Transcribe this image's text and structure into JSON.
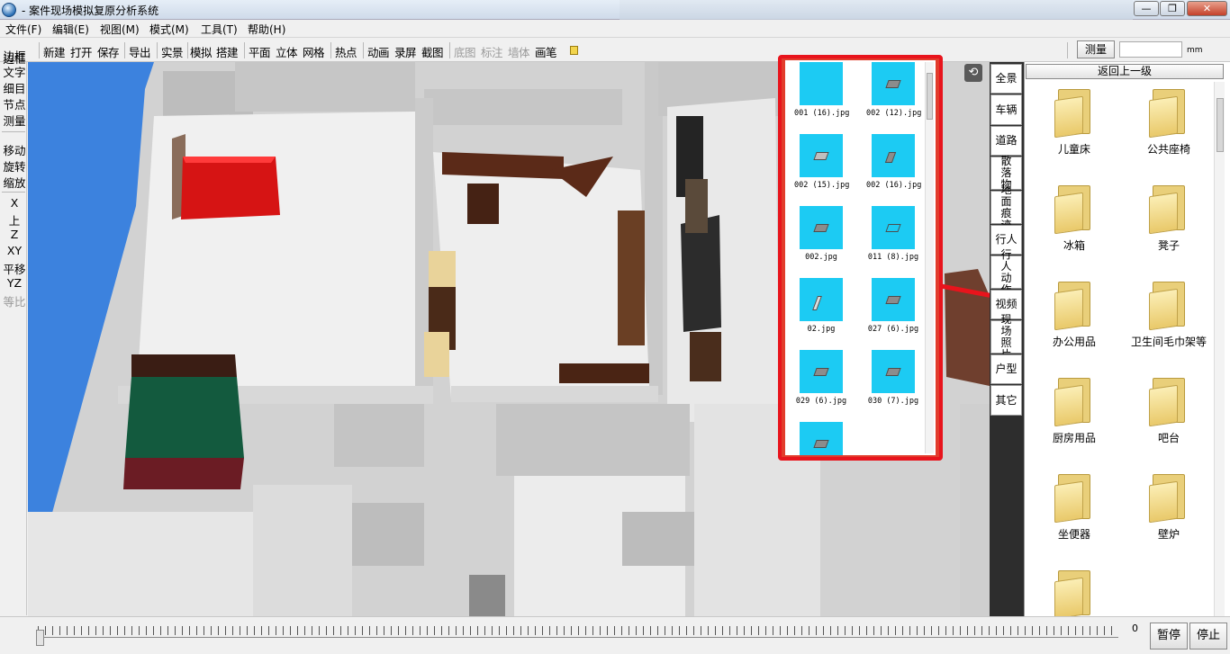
{
  "window": {
    "title": "- 案件现场模拟复原分析系统",
    "minimize": "—",
    "maximize": "❐",
    "close": "✕"
  },
  "menu": [
    "文件(F)",
    "编辑(E)",
    "视图(M)",
    "模式(M)",
    "工具(T)",
    "帮助(H)"
  ],
  "toolbar": {
    "groups": [
      [
        "新建",
        "打开",
        "保存"
      ],
      [
        "导出"
      ],
      [
        "实景",
        "模拟",
        "搭建"
      ],
      [
        "平面",
        "立体",
        "网格"
      ],
      [
        "热点"
      ],
      [
        "动画",
        "录屏",
        "截图"
      ],
      [
        "底图",
        "标注",
        "墙体",
        "画笔"
      ]
    ],
    "disabled": [
      "底图",
      "标注",
      "墙体"
    ],
    "measure_label": "测量",
    "measure_value": "",
    "unit": "mm"
  },
  "left_tools": {
    "groups": [
      [
        "边框",
        "文字",
        "细目",
        "节点",
        "测量"
      ],
      [
        "移动",
        "旋转",
        "缩放"
      ],
      [
        "X",
        "上",
        "Z",
        "XY",
        "平移",
        "YZ",
        "等比"
      ]
    ],
    "disabled": [
      "等比"
    ]
  },
  "thumbnails": [
    {
      "label": "001 (16).jpg"
    },
    {
      "label": "002 (12).jpg"
    },
    {
      "label": "002 (15).jpg"
    },
    {
      "label": "002 (16).jpg"
    },
    {
      "label": "002.jpg"
    },
    {
      "label": "011 (8).jpg"
    },
    {
      "label": "02.jpg"
    },
    {
      "label": "027 (6).jpg"
    },
    {
      "label": "029 (6).jpg"
    },
    {
      "label": "030 (7).jpg"
    },
    {
      "label": ""
    }
  ],
  "categories": [
    "全景",
    "车辆",
    "道路",
    "散落物",
    "地面痕迹",
    "行人",
    "行人动作",
    "视频",
    "现场照片",
    "户型",
    "其它"
  ],
  "folder_panel": {
    "back_label": "返回上一级",
    "folders": [
      "儿童床",
      "公共座椅",
      "冰箱",
      "凳子",
      "办公用品",
      "卫生间毛巾架等",
      "厨房用品",
      "吧台",
      "坐便器",
      "壁炉",
      ""
    ]
  },
  "bottom": {
    "time_value": "0",
    "pause": "暂停",
    "stop": "停止"
  },
  "colors": {
    "highlight": "#e8141c",
    "thumb_bg": "#1ccbf3",
    "scene_blue": "#3c82de"
  }
}
